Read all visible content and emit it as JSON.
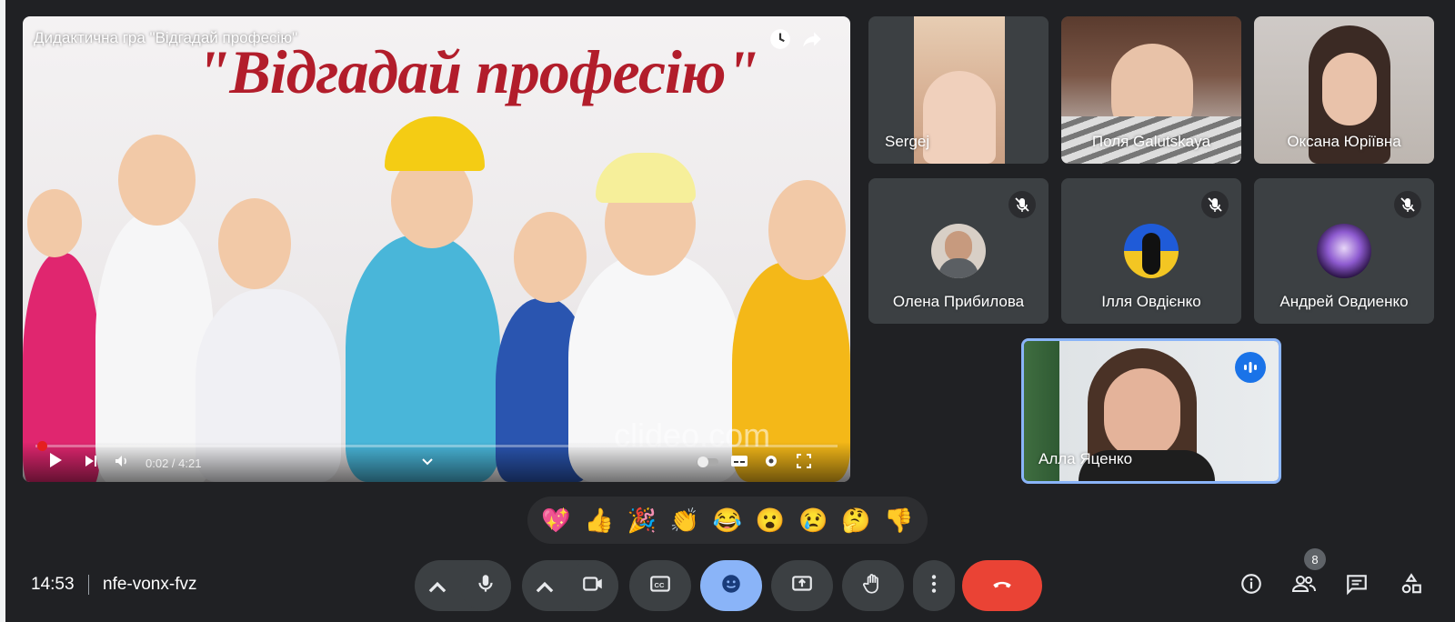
{
  "presentation": {
    "video_title": "Дидактична гра \"Відгадай професію\"",
    "headline": "\"Відгадай професію\"",
    "time": "0:02 / 4:21",
    "watermark": "clideo.com",
    "progress_fraction": 0.005
  },
  "participants": [
    {
      "name": "Sergej",
      "muted": false,
      "video": true
    },
    {
      "name": "Поля Galutskaya",
      "muted": false,
      "video": true
    },
    {
      "name": "Оксана Юріївна",
      "muted": false,
      "video": true
    },
    {
      "name": "Олена Прибилова",
      "muted": true,
      "video": false
    },
    {
      "name": "Ілля Овдієнко",
      "muted": true,
      "video": false
    },
    {
      "name": "Андрей Овдиенко",
      "muted": true,
      "video": false
    },
    {
      "name": "Алла Яценко",
      "muted": false,
      "video": true,
      "speaking": true
    }
  ],
  "reactions": [
    "💖",
    "👍",
    "🎉",
    "👏",
    "😂",
    "😮",
    "😢",
    "🤔",
    "👎"
  ],
  "bottom_bar": {
    "clock": "14:53",
    "meeting_code": "nfe-vonx-fvz",
    "participant_count": "8"
  },
  "icons": {
    "mic": "mic-icon",
    "camera": "camera-icon",
    "captions": "captions-icon",
    "emoji": "emoji-icon",
    "present": "present-screen-icon",
    "hand": "raise-hand-icon",
    "more": "more-vert-icon",
    "hangup": "hangup-icon",
    "info": "info-icon",
    "people": "people-icon",
    "chat": "chat-icon",
    "activities": "activities-icon"
  },
  "colors": {
    "background": "#202124",
    "tile": "#3c4043",
    "hangup": "#ea4335",
    "active_emoji_button": "#8ab4f8",
    "speaking_border": "#8ab4f8",
    "headline": "#b21d2b"
  }
}
